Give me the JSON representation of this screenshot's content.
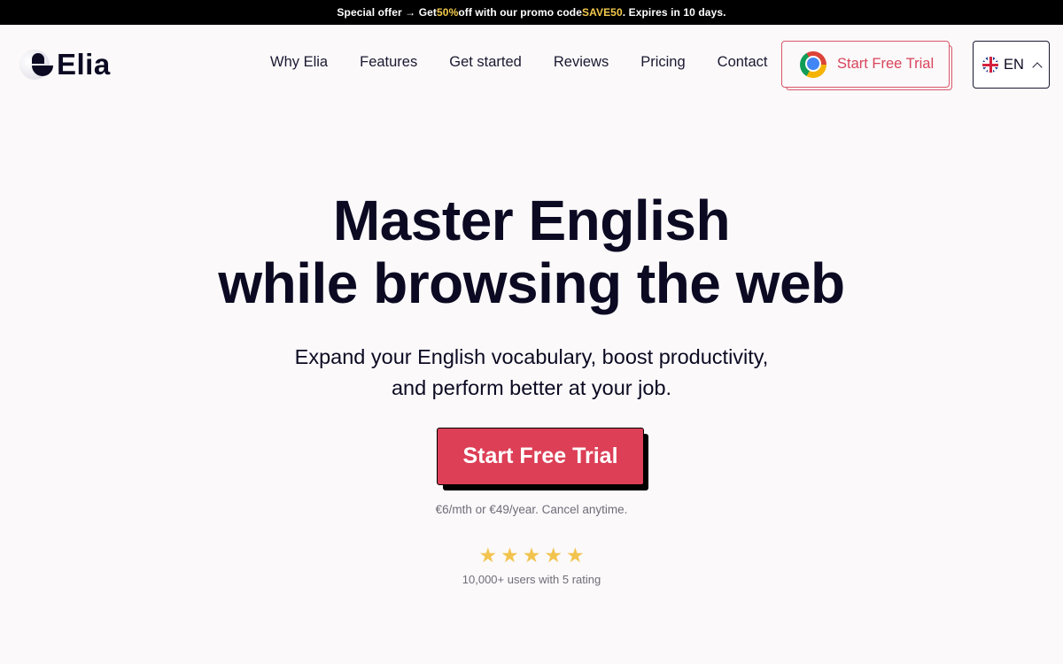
{
  "promo": {
    "prefix": "Special offer → Get ",
    "discount": "50%",
    "middle": " off with our promo code ",
    "code": "SAVE50",
    "suffix": ". Expires in 10 days.",
    "highlight_color": "#f2c94c"
  },
  "brand": {
    "name": "Elia",
    "logo_icon": "elia-logo-icon"
  },
  "nav": {
    "items": [
      {
        "label": "Why Elia"
      },
      {
        "label": "Features"
      },
      {
        "label": "Get started"
      },
      {
        "label": "Reviews"
      },
      {
        "label": "Pricing"
      },
      {
        "label": "Contact"
      }
    ]
  },
  "header_cta": {
    "label": "Start Free Trial",
    "icon": "chrome-icon",
    "color": "#d9455c"
  },
  "language": {
    "code": "EN",
    "flag_icon": "uk-flag-icon",
    "chevron_icon": "chevron-up-icon"
  },
  "hero": {
    "title_line1": "Master English",
    "title_line2": "while browsing the web",
    "subtitle_line1": "Expand your English vocabulary, boost productivity,",
    "subtitle_line2": "and perform better at your job.",
    "cta_label": "Start Free Trial",
    "cta_color": "#dc3f56",
    "price_note": "€6/mth or €49/year. Cancel anytime.",
    "rating": {
      "stars": 5,
      "max": 5,
      "glyph": "★",
      "note": "10,000+ users with 5 rating"
    }
  }
}
